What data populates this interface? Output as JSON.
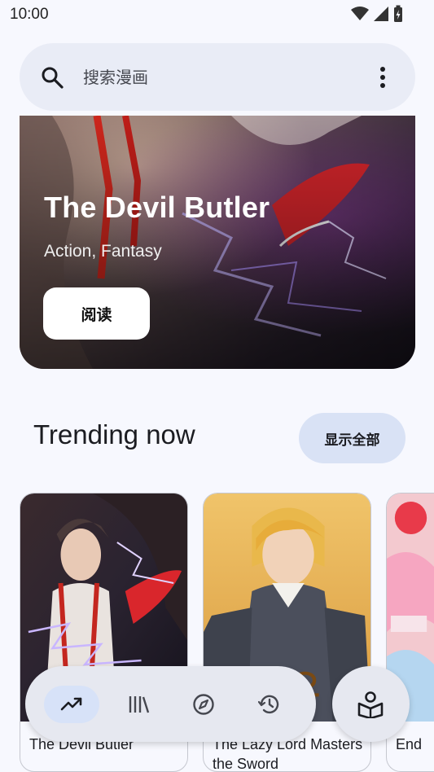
{
  "status_bar": {
    "time": "10:00"
  },
  "search": {
    "placeholder": "搜索漫画"
  },
  "hero": {
    "title": "The Devil Butler",
    "genres": "Action, Fantasy",
    "read_label": "阅读"
  },
  "trending": {
    "title": "Trending now",
    "show_all_label": "显示全部",
    "items": [
      {
        "title": "The Devil Butler"
      },
      {
        "title": "The Lazy Lord Masters the Sword"
      },
      {
        "title": "End"
      }
    ]
  },
  "bottom_nav": {
    "items": [
      {
        "icon": "trending-icon",
        "active": true
      },
      {
        "icon": "library-icon",
        "active": false
      },
      {
        "icon": "explore-icon",
        "active": false
      },
      {
        "icon": "history-icon",
        "active": false
      }
    ],
    "fab_icon": "reader-icon"
  },
  "colors": {
    "background": "#f7f8fe",
    "search_bg": "#e9ecf6",
    "chip_bg": "#d9e2f5",
    "nav_active": "#d7e2f8"
  }
}
